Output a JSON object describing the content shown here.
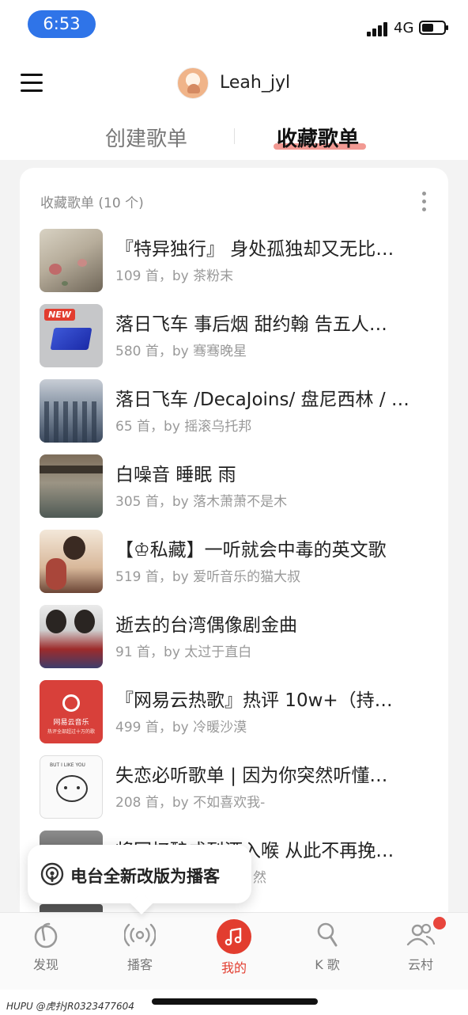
{
  "status_bar": {
    "time": "6:53",
    "network": "4G"
  },
  "header": {
    "username": "Leah_jyl"
  },
  "tabs": {
    "create": "创建歌单",
    "favorites": "收藏歌单"
  },
  "section": {
    "title": "收藏歌单 (10 个)"
  },
  "playlists": [
    {
      "title": "『特异独行』 身处孤独却又无比…",
      "subtitle": "109 首，by 茶粉末"
    },
    {
      "title": "落日飞车 事后烟 甜约翰 告五人…",
      "subtitle": "580 首，by 骞骞晚星",
      "badge": "NEW"
    },
    {
      "title": "落日飞车 /DecaJoins/ 盘尼西林 / …",
      "subtitle": "65 首，by 摇滚乌托邦"
    },
    {
      "title": "白噪音 睡眠 雨",
      "subtitle": "305 首，by 落木萧萧不是木"
    },
    {
      "title": "【♔私藏】一听就会中毒的英文歌",
      "subtitle": "519 首，by 爱听音乐的猫大叔"
    },
    {
      "title": "逝去的台湾偶像剧金曲",
      "subtitle": "91 首，by 太过于直白"
    },
    {
      "title": "『网易云热歌』热评 10w+（持…",
      "subtitle": "499 首，by 冷暖沙漠",
      "cover_text": "网易云音乐",
      "cover_subtext": "热评全部超过十万的歌"
    },
    {
      "title": "失恋必听歌单 | 因为你突然听懂…",
      "subtitle": "208 首，by 不如喜欢我-",
      "cover_text": "BUT I LIKE YOU"
    },
    {
      "title": "将回忆酿成烈酒入喉 从此不再挽…",
      "subtitle": "然"
    }
  ],
  "toast": {
    "text": "电台全新改版为播客"
  },
  "tabbar": {
    "discover": "发现",
    "podcast": "播客",
    "mine": "我的",
    "k": "K 歌",
    "village": "云村"
  },
  "watermark": "HUPU @虎扑JR0323477604",
  "colors": {
    "accent": "#e23d2f",
    "time_pill": "#2f74e8",
    "underline": "#f08880"
  }
}
